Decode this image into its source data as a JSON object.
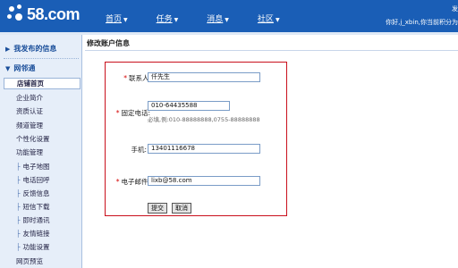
{
  "header": {
    "logo_text": "58.com",
    "nav": [
      {
        "label": "首页"
      },
      {
        "label": "任务"
      },
      {
        "label": "消息"
      },
      {
        "label": "社区"
      }
    ],
    "right_top": "发",
    "user_text": "你好,j_xbin,你当前积分为"
  },
  "sidebar": {
    "section1": "我发布的信息",
    "section2": "网邻通",
    "items": [
      "店铺首页",
      "企业简介",
      "资质认证",
      "频道管理",
      "个性化设置",
      "功能管理"
    ],
    "sub_items": [
      "电子地图",
      "电话回呼",
      "反馈信息",
      "短信下载",
      "即时通讯",
      "友情链接",
      "功能设置"
    ],
    "bottom_item": "网页预览"
  },
  "main": {
    "title": "修改账户信息",
    "form": {
      "contact_label": "联系人:",
      "contact_value": "仟先生",
      "phone_label": "固定电话:",
      "phone_value": "010-64435588",
      "phone_hint": "必填,例:010-88888888,0755-88888888",
      "mobile_label": "手机:",
      "mobile_value": "13401116678",
      "email_label": "电子邮件:",
      "email_value": "lixb@58.com",
      "submit_label": "提交",
      "cancel_label": "取消"
    }
  },
  "colors": {
    "header_blue": "#1a5eb6",
    "sidebar_bg": "#e6eef9",
    "form_border": "#c9101c",
    "required_star": "#d40000"
  },
  "icons": [
    "logo-dots-icon",
    "caret-down-icon",
    "triangle-right-icon",
    "tree-branch-icon"
  ]
}
